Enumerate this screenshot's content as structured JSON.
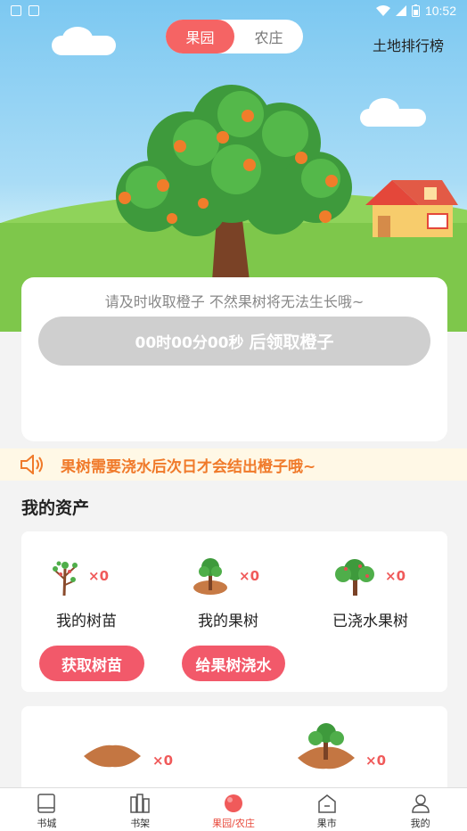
{
  "status_bar": {
    "time": "10:52"
  },
  "header": {
    "tabs": [
      {
        "label": "果园",
        "active": true
      },
      {
        "label": "农庄",
        "active": false
      }
    ],
    "ranking_link": "土地排行榜"
  },
  "harvest": {
    "hint": "请及时收取橙子 不然果树将无法生长哦~",
    "countdown": "00时00分00秒",
    "action": "后领取橙子"
  },
  "notice": {
    "text": "果树需要浇水后次日才会结出橙子哦~"
  },
  "assets": {
    "title": "我的资产",
    "items": [
      {
        "icon": "sapling-icon",
        "count": "×0",
        "label": "我的树苗"
      },
      {
        "icon": "fruit-tree-icon",
        "count": "×0",
        "label": "我的果树"
      },
      {
        "icon": "watered-tree-icon",
        "count": "×0",
        "label": "已浇水果树"
      }
    ],
    "buttons": [
      "获取树苗",
      "给果树浇水"
    ]
  },
  "land": {
    "items": [
      {
        "icon": "empty-land-icon",
        "count": "×0"
      },
      {
        "icon": "planted-land-icon",
        "count": "×0"
      }
    ]
  },
  "tabbar": {
    "items": [
      {
        "label": "书城",
        "icon": "book-icon",
        "active": false
      },
      {
        "label": "书架",
        "icon": "bookshelf-icon",
        "active": false
      },
      {
        "label": "果园/农庄",
        "icon": "orchard-icon",
        "active": true
      },
      {
        "label": "果市",
        "icon": "market-icon",
        "active": false
      },
      {
        "label": "我的",
        "icon": "user-icon",
        "active": false
      }
    ]
  },
  "colors": {
    "accent": "#f56464",
    "notice_text": "#f07a2a",
    "count": "#f05a5a",
    "active_tab": "#e8493b"
  }
}
